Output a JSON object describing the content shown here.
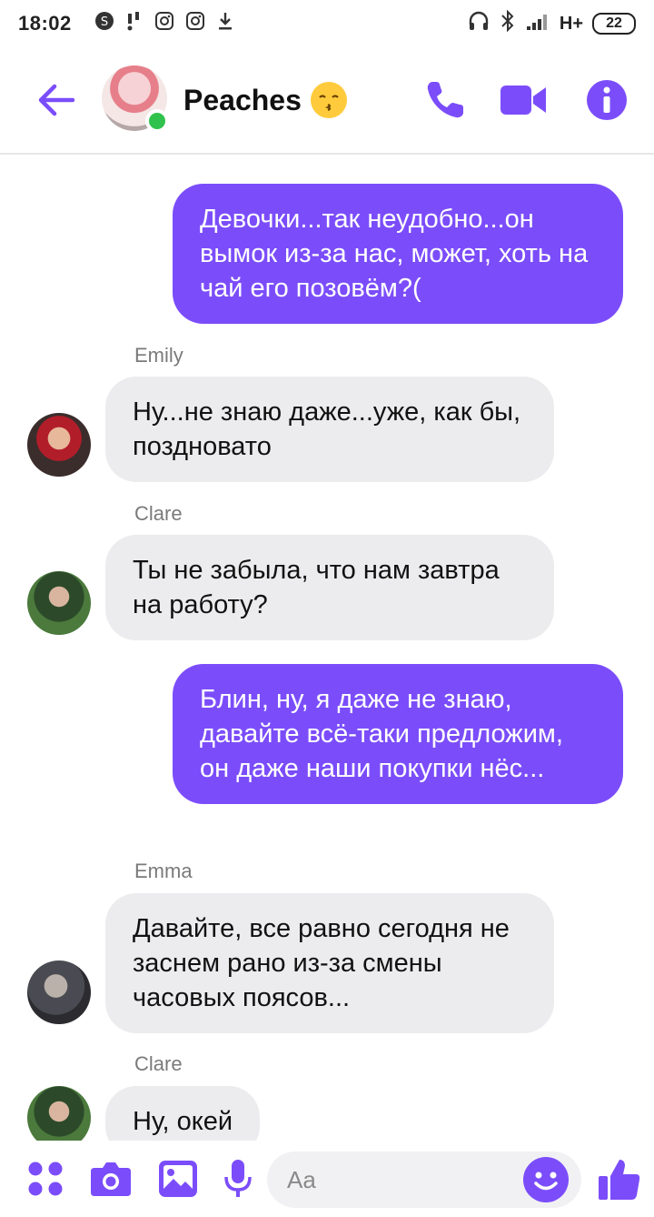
{
  "status_bar": {
    "time": "18:02",
    "network": "H+",
    "battery": "22"
  },
  "header": {
    "contact_name": "Peaches",
    "emoji": "😚"
  },
  "messages": [
    {
      "type": "outgoing",
      "text": "Девочки...так неудобно...он вымок из-за нас, может, хоть на чай его позовём?("
    },
    {
      "type": "incoming",
      "sender": "Emily",
      "text": "Ну...не знаю даже...уже, как бы, поздновато"
    },
    {
      "type": "incoming",
      "sender": "Clare",
      "text": "Ты не забыла, что нам завтра на работу?"
    },
    {
      "type": "outgoing",
      "text": "Блин, ну, я даже не знаю, давайте всё-таки предложим, он даже наши покупки нёс..."
    },
    {
      "type": "incoming",
      "sender": "Emma",
      "text": "Давайте, все равно сегодня не заснем рано из-за смены часовых поясов..."
    },
    {
      "type": "incoming",
      "sender": "Clare",
      "text": "Ну, окей"
    }
  ],
  "composer": {
    "placeholder": "Aa"
  },
  "colors": {
    "accent": "#7b4dfa",
    "incoming_bubble": "#ececee",
    "online": "#31c24d"
  },
  "icons": [
    "back-arrow-icon",
    "phone-icon",
    "video-icon",
    "info-icon",
    "apps-icon",
    "camera-icon",
    "gallery-icon",
    "microphone-icon",
    "emoji-icon",
    "thumbs-up-icon"
  ]
}
